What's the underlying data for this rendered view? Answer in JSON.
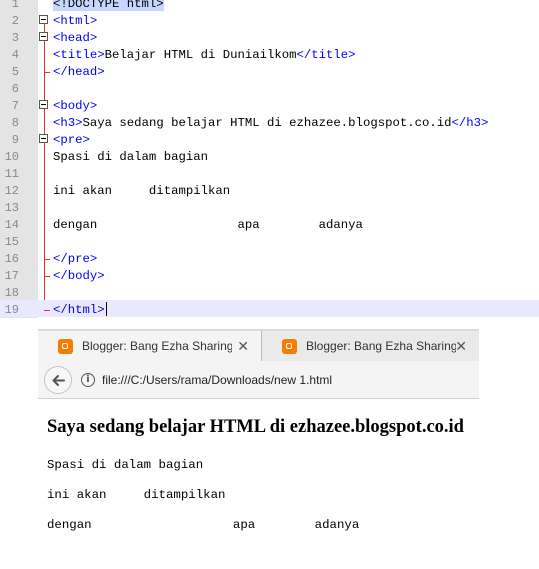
{
  "editor": {
    "line_numbers": [
      "1",
      "2",
      "3",
      "4",
      "5",
      "6",
      "7",
      "8",
      "9",
      "10",
      "11",
      "12",
      "13",
      "14",
      "15",
      "16",
      "17",
      "18",
      "19"
    ],
    "lines": {
      "l1": "<!DOCTYPE html>",
      "l2": "<html>",
      "l3": "<head>",
      "l4_open": "<title>",
      "l4_text": "Belajar HTML di Duniailkom",
      "l4_close": "</title>",
      "l5": "</head>",
      "l7": "<body>",
      "l8_open": "<h3>",
      "l8_text": "Saya sedang belajar HTML di ezhazee.blogspot.co.id",
      "l8_close": "</h3>",
      "l9": "<pre>",
      "l10": "Spasi di dalam bagian",
      "l12": "ini akan     ditampilkan",
      "l14": "dengan                   apa        adanya",
      "l16": "</pre>",
      "l17": "</body>",
      "l19": "</html>"
    }
  },
  "browser": {
    "tabs": [
      {
        "label": "Blogger: Bang Ezha Sharing -",
        "close": "✕"
      },
      {
        "label": "Blogger: Bang Ezha Sharing -",
        "close": "✕"
      }
    ],
    "url": "file:///C:/Users/rama/Downloads/new 1.html",
    "info_glyph": "i",
    "page": {
      "heading": "Saya sedang belajar HTML di ezhazee.blogspot.co.id",
      "pre_line1": "Spasi di dalam bagian",
      "pre_line2": "ini akan     ditampilkan",
      "pre_line3": "dengan                   apa        adanya"
    }
  },
  "colors": {
    "tag": "#0000ff",
    "fold_marker": "#dd3333",
    "favicon": "#f57d00",
    "gutter": "#e4e4e4"
  },
  "icons": [
    "fold-minus-icon",
    "back-arrow-icon",
    "info-icon",
    "blogger-favicon-icon",
    "close-icon"
  ]
}
